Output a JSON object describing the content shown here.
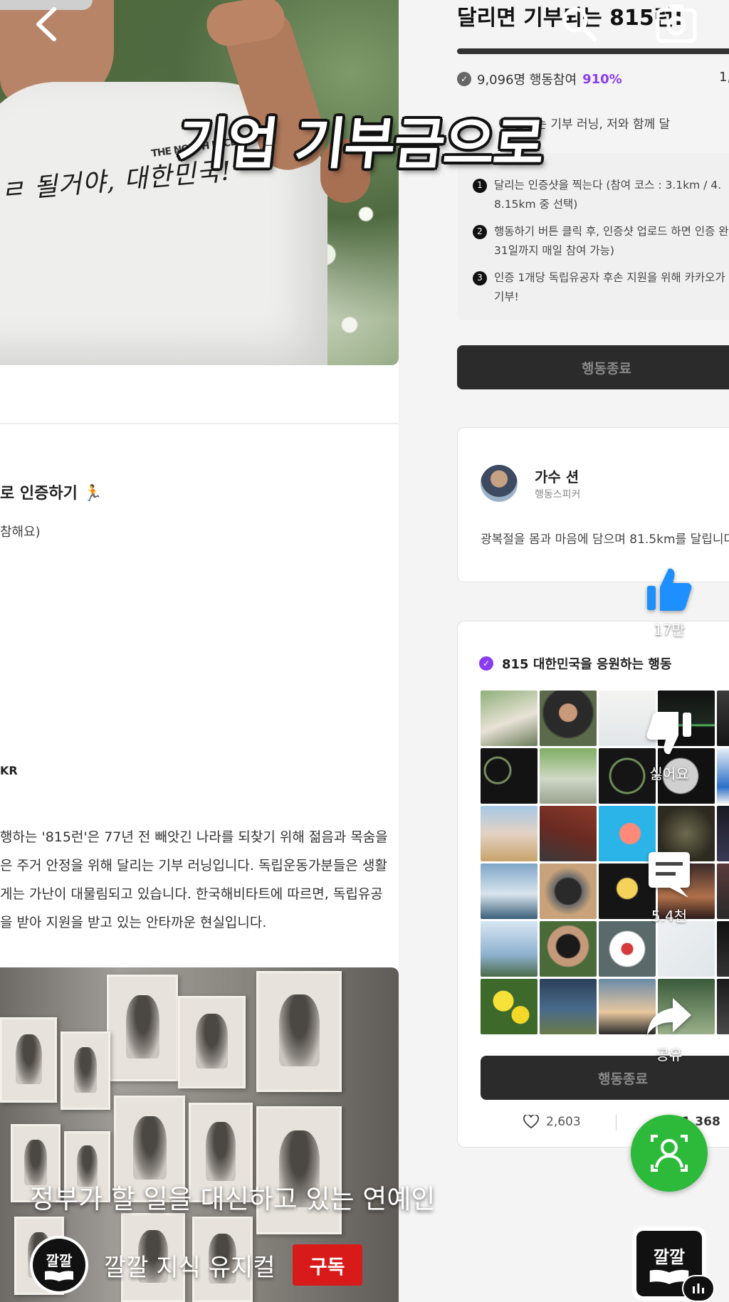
{
  "overlay": {
    "caption": "기업 기부금으로",
    "video_title": "정부가 할 일을 대신하고 있는 연예인",
    "channel_name": "깔깔 지식 유지컬",
    "channel_avatar_text": "깔깔",
    "subscribe_label": "구독",
    "like_count": "17만",
    "dislike_label": "싫어요",
    "comment_count": "5.4천",
    "share_label": "공유",
    "music_thumb_text": "깔깔"
  },
  "left_page": {
    "shirt_logo": "THE NORTH FACE",
    "shirt_script": "ㄹ 될거야, 대한민국!",
    "cert_title": "로 인증하기 🏃",
    "cert_sub": "참해요)",
    "kr_label": "KR",
    "paragraph": [
      "행하는 '815런'은 77년 전 빼앗긴 나라를 되찾기 위해 젊음과 목숨을",
      "은 주거 안정을 위해 달리는 기부 러닝입니다. 독립운동가분들은 생활",
      "게는 가난이 대물림되고 있습니다. 한국해비타트에 따르면, 독립유공",
      "을 받아 지원을 받고 있는 안타까운 현실입니다."
    ]
  },
  "right_page": {
    "campaign_title": "달리면 기부되는 815런!",
    "progress_fraction": 1.0,
    "participants": "9,096명 행동참여",
    "percent": "910%",
    "stats_right": "1,",
    "intro_text": "에 챙기는 기부 러닝, 저와 함께 달",
    "howto": [
      {
        "num": "1",
        "line1": "달리는 인증샷을 찍는다 (참여 코스 : 3.1km / 4.",
        "line2": "8.15km 중 선택)"
      },
      {
        "num": "2",
        "line1": "행동하기 버튼 클릭 후, 인증샷 업로드 하면 인증 완",
        "line2": "31일까지 매일 참여 가능)"
      },
      {
        "num": "3",
        "line1": "인증 1개당 독립유공자 후손 지원을 위해 카카오가",
        "line2": "기부!"
      }
    ],
    "end_button": "행동종료",
    "speaker": {
      "name": "가수 션",
      "role": "행동스피커",
      "quote": "광복절을 몸과 마음에 담으며 81.5km를 달립니다"
    },
    "gallery": {
      "title": "815 대한민국을 응원하는 행동",
      "end_button": "행동종료",
      "likes": "2,603",
      "comments": "1,368"
    }
  },
  "colors": {
    "accent_purple": "#8a3df0",
    "subscribe_red": "#d81a1a",
    "remix_green": "#2dba3a",
    "like_blue": "#1e8fff"
  }
}
